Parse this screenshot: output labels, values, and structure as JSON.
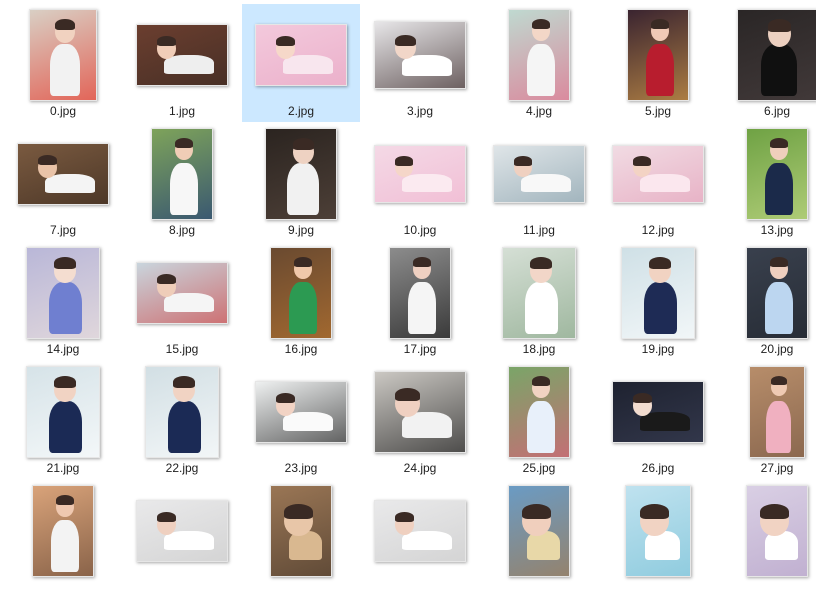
{
  "files": [
    {
      "name": "0.jpg",
      "bg": "#d9cfc4",
      "skin": "#f1d2c0",
      "cloth": "#f2f2f2",
      "accent": "#e63b2e",
      "orient": "p",
      "selected": false
    },
    {
      "name": "1.jpg",
      "bg": "#6b3e2f",
      "skin": "#f0cdb8",
      "cloth": "#eeeeee",
      "accent": "#3a2a22",
      "orient": "l",
      "selected": false
    },
    {
      "name": "2.jpg",
      "bg": "#f3c9dc",
      "skin": "#f6d8c9",
      "cloth": "#f8e6ee",
      "accent": "#e8a7c4",
      "orient": "l",
      "selected": true
    },
    {
      "name": "3.jpg",
      "bg": "#e7e6e8",
      "skin": "#f1d6c8",
      "cloth": "#ffffff",
      "accent": "#3c2b2b",
      "orient": "l",
      "selected": false
    },
    {
      "name": "4.jpg",
      "bg": "#bfd9d0",
      "skin": "#f3d7c7",
      "cloth": "#f5f5f5",
      "accent": "#e56b8a",
      "orient": "p",
      "selected": false
    },
    {
      "name": "5.jpg",
      "bg": "#3a2430",
      "skin": "#f0c9b6",
      "cloth": "#b81d2e",
      "accent": "#d9a04a",
      "orient": "p",
      "selected": false
    },
    {
      "name": "6.jpg",
      "bg": "#2a2626",
      "skin": "#ecd0c0",
      "cloth": "#101010",
      "accent": "#4a4040",
      "orient": "p",
      "selected": false
    },
    {
      "name": "7.jpg",
      "bg": "#7a5a40",
      "skin": "#e9c3a8",
      "cloth": "#f4f4f4",
      "accent": "#3b2a1e",
      "orient": "l",
      "selected": false
    },
    {
      "name": "8.jpg",
      "bg": "#7ea35a",
      "skin": "#f0cdb6",
      "cloth": "#f7f7f7",
      "accent": "#1f3b7a",
      "orient": "p",
      "selected": false
    },
    {
      "name": "9.jpg",
      "bg": "#2b2420",
      "skin": "#eed2c2",
      "cloth": "#f1f1f1",
      "accent": "#5a4a40",
      "orient": "p",
      "selected": false
    },
    {
      "name": "10.jpg",
      "bg": "#f4d9e6",
      "skin": "#f5d6c8",
      "cloth": "#fbeaf0",
      "accent": "#f0b5cf",
      "orient": "l",
      "selected": false
    },
    {
      "name": "11.jpg",
      "bg": "#dfe5e8",
      "skin": "#efd0c0",
      "cloth": "#f8f8f8",
      "accent": "#8aa2ad",
      "orient": "l",
      "selected": false
    },
    {
      "name": "12.jpg",
      "bg": "#f1dbe3",
      "skin": "#f3d3c4",
      "cloth": "#fbe7ee",
      "accent": "#e4a3bb",
      "orient": "l",
      "selected": false
    },
    {
      "name": "13.jpg",
      "bg": "#6fa244",
      "skin": "#efcfbc",
      "cloth": "#1b2a4a",
      "accent": "#c7dc8a",
      "orient": "p",
      "selected": false
    },
    {
      "name": "14.jpg",
      "bg": "#b9b7d8",
      "skin": "#f4ddd0",
      "cloth": "#6f7fd0",
      "accent": "#efe3dd",
      "orient": "p",
      "selected": false
    },
    {
      "name": "15.jpg",
      "bg": "#c9d5dd",
      "skin": "#efcdb9",
      "cloth": "#f5f5f5",
      "accent": "#cf4a4a",
      "orient": "l",
      "selected": false
    },
    {
      "name": "16.jpg",
      "bg": "#6a4a30",
      "skin": "#f0c8aa",
      "cloth": "#2c9a52",
      "accent": "#b7742f",
      "orient": "p",
      "selected": false
    },
    {
      "name": "17.jpg",
      "bg": "#8c8c8c",
      "skin": "#efd0c1",
      "cloth": "#f5f5f5",
      "accent": "#1a1a1a",
      "orient": "p",
      "selected": false
    },
    {
      "name": "18.jpg",
      "bg": "#d5dfd5",
      "skin": "#f2d6c8",
      "cloth": "#ffffff",
      "accent": "#8aa88a",
      "orient": "p",
      "selected": false
    },
    {
      "name": "19.jpg",
      "bg": "#cfe0e6",
      "skin": "#f1d3c2",
      "cloth": "#1e2b55",
      "accent": "#ffffff",
      "orient": "p",
      "selected": false
    },
    {
      "name": "20.jpg",
      "bg": "#39404d",
      "skin": "#efcfbf",
      "cloth": "#bcd6f0",
      "accent": "#20252d",
      "orient": "p",
      "selected": false
    },
    {
      "name": "21.jpg",
      "bg": "#d6e3e8",
      "skin": "#f1d3c3",
      "cloth": "#1b2a55",
      "accent": "#ffffff",
      "orient": "p",
      "selected": false
    },
    {
      "name": "22.jpg",
      "bg": "#d2dfe4",
      "skin": "#f1d3c3",
      "cloth": "#1b2a55",
      "accent": "#ffffff",
      "orient": "p",
      "selected": false
    },
    {
      "name": "23.jpg",
      "bg": "#eef0f0",
      "skin": "#f2d3c4",
      "cloth": "#fafafa",
      "accent": "#2a2a2a",
      "orient": "l",
      "selected": false
    },
    {
      "name": "24.jpg",
      "bg": "#cbc8c3",
      "skin": "#efd0c1",
      "cloth": "#f2f2f2",
      "accent": "#1c1c1c",
      "orient": "l",
      "selected": false
    },
    {
      "name": "25.jpg",
      "bg": "#7aa568",
      "skin": "#f1d3c2",
      "cloth": "#e8f0fa",
      "accent": "#e05a7a",
      "orient": "p",
      "selected": false
    },
    {
      "name": "26.jpg",
      "bg": "#1e2230",
      "skin": "#f2dccf",
      "cloth": "#1a1a1a",
      "accent": "#3a3f55",
      "orient": "l",
      "selected": false
    },
    {
      "name": "27.jpg",
      "bg": "#b78d6a",
      "skin": "#efcab3",
      "cloth": "#f0b0c0",
      "accent": "#7a5a45",
      "orient": "p",
      "selected": false
    },
    {
      "name": "",
      "bg": "#d9a37a",
      "skin": "#efc8b0",
      "cloth": "#f3f3f3",
      "accent": "#6a4a36",
      "orient": "p",
      "selected": false
    },
    {
      "name": "",
      "bg": "#e9e9ea",
      "skin": "#efd0c0",
      "cloth": "#ffffff",
      "accent": "#cccccc",
      "orient": "l",
      "selected": false
    },
    {
      "name": "",
      "bg": "#9a7655",
      "skin": "#e8c6a8",
      "cloth": "#d9b890",
      "accent": "#4a3a2c",
      "orient": "l",
      "selected": false
    },
    {
      "name": "",
      "bg": "#e9e9ea",
      "skin": "#efd0c0",
      "cloth": "#ffffff",
      "accent": "#cccccc",
      "orient": "l",
      "selected": false
    },
    {
      "name": "",
      "bg": "#6a9bc4",
      "skin": "#f0cfbd",
      "cloth": "#e8d8a8",
      "accent": "#a5794b",
      "orient": "l",
      "selected": false
    },
    {
      "name": "",
      "bg": "#bfe2ef",
      "skin": "#f1d3c3",
      "cloth": "#ffffff",
      "accent": "#7dc3d8",
      "orient": "l",
      "selected": false
    },
    {
      "name": "",
      "bg": "#d9cfe4",
      "skin": "#f1d3c3",
      "cloth": "#ffffff",
      "accent": "#b7a4c9",
      "orient": "l",
      "selected": false
    }
  ]
}
